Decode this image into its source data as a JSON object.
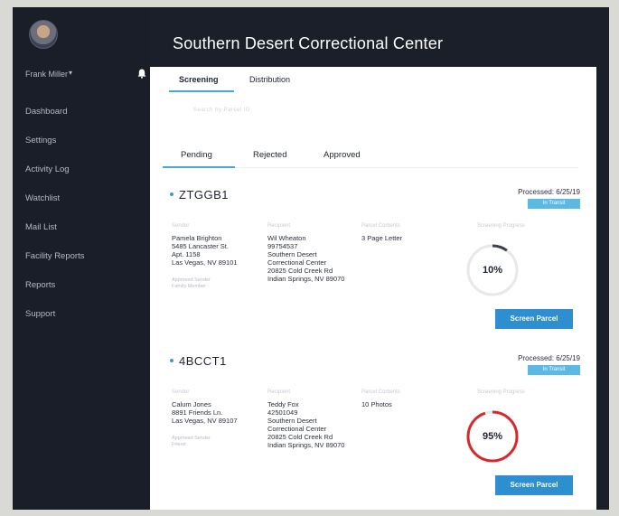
{
  "app": {
    "title": "Southern Desert Correctional Center"
  },
  "sidebar": {
    "user_name": "Frank Miller",
    "items": [
      {
        "label": "Dashboard"
      },
      {
        "label": "Settings"
      },
      {
        "label": "Activity Log"
      },
      {
        "label": "Watchlist"
      },
      {
        "label": "Mail List"
      },
      {
        "label": "Facility Reports"
      },
      {
        "label": "Reports"
      },
      {
        "label": "Support"
      }
    ]
  },
  "tabs_top": [
    {
      "label": "Screening",
      "active": true
    },
    {
      "label": "Distribution",
      "active": false
    }
  ],
  "search": {
    "hint": "Search by Parcel ID"
  },
  "tabs_sub": [
    {
      "label": "Pending",
      "active": true
    },
    {
      "label": "Rejected",
      "active": false
    },
    {
      "label": "Approved",
      "active": false
    }
  ],
  "parcels": [
    {
      "id": "ZTGGB1",
      "processed": "Processed: 6/25/19",
      "status": "In Transit",
      "sender_label": "Sender",
      "sender_lines": [
        "Pamela Brighton",
        "5485 Lancaster St.",
        "Apt. 1158",
        "Las Vegas, NV 89101"
      ],
      "sender_note": [
        "Approved Sender",
        "Family Member"
      ],
      "recipient_label": "Recipient",
      "recipient_lines": [
        "Wil Wheaton",
        "99754537",
        "Southern Desert",
        "Correctional Center",
        "20825 Cold Creek Rd",
        "Indian Springs, NV 89070"
      ],
      "contents_label": "Parcel Contents",
      "contents": "3 Page Letter",
      "progress_label": "Screening Progress",
      "progress": "10%",
      "progress_value": 0.1,
      "ring_color": "#3a3f4b",
      "button": "Screen Parcel"
    },
    {
      "id": "4BCCT1",
      "processed": "Processed: 6/25/19",
      "status": "In Transit",
      "sender_label": "Sender",
      "sender_lines": [
        "Calum Jones",
        "8891 Friends Ln.",
        "Las Vegas, NV 89107"
      ],
      "sender_note": [
        "Approved Sender",
        "Friend"
      ],
      "recipient_label": "Recipient",
      "recipient_lines": [
        "Teddy Fox",
        "42501049",
        "Southern Desert",
        "Correctional Center",
        "20825 Cold Creek Rd",
        "Indian Springs, NV 89070"
      ],
      "contents_label": "Parcel Contents",
      "contents": "10 Photos",
      "progress_label": "Screening Progress",
      "progress": "95%",
      "progress_value": 0.95,
      "ring_color": "#d8282c",
      "button": "Screen Parcel"
    }
  ]
}
